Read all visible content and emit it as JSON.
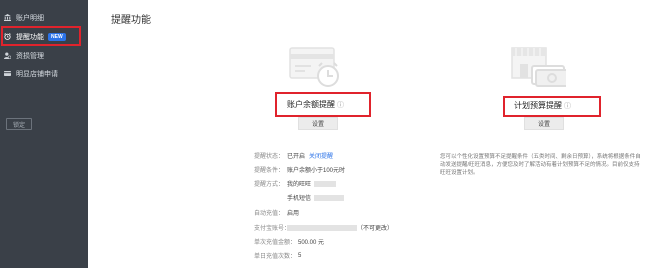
{
  "sidebar": {
    "items": [
      {
        "label": "账户明细",
        "icon": "bank-icon"
      },
      {
        "label": "提醒功能",
        "icon": "alarm-clock-icon",
        "badge": "NEW",
        "active": true
      },
      {
        "label": "资损管理",
        "icon": "user-money-icon"
      },
      {
        "label": "明显店铺申请",
        "icon": "card-icon"
      }
    ],
    "lock_label": "锁定"
  },
  "page": {
    "title": "提醒功能"
  },
  "cards": {
    "balance": {
      "title": "账户余额提醒",
      "info_icon": "ⓘ",
      "button": "设置"
    },
    "budget": {
      "title": "计划预算提醒",
      "info_icon": "ⓘ",
      "button": "设置"
    }
  },
  "balance_details": {
    "status": {
      "label": "提醒状态：",
      "value": "已开启",
      "link": "关闭提醒"
    },
    "condition": {
      "label": "提醒条件：",
      "value": "账户余额小于100元时"
    },
    "method": {
      "label": "提醒方式：",
      "value1": "我的旺旺",
      "value2": "手机短信"
    },
    "auto_recharge": {
      "label": "自动充值：",
      "value": "启用"
    },
    "pay_account": {
      "label": "支付宝账号：",
      "note": "（不可更改）"
    },
    "single_amount": {
      "label": "单次充值金额：",
      "value": "500.00 元"
    },
    "daily_count": {
      "label": "单日充值次数：",
      "value": "5"
    }
  },
  "budget_note": "您可以个性化设置预算不足提醒条件（五类时间、剩余日预算），系统将根据条件自动发送提醒/旺旺消息，方便您及时了解活动有着计划预算不足的情况。目前仅支持旺旺设置计划。",
  "colors": {
    "sidebar_bg": "#3a4048",
    "highlight": "#e0232c",
    "accent": "#2b73e8"
  }
}
